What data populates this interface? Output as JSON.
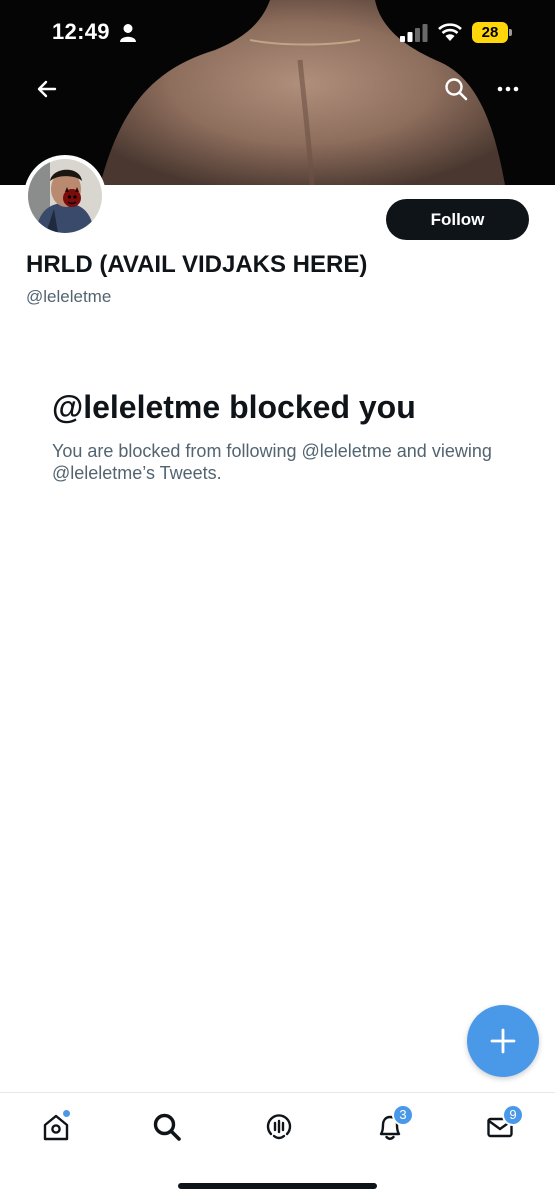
{
  "status_bar": {
    "time": "12:49",
    "battery": "28"
  },
  "profile": {
    "display_name": "HRLD (AVAIL VIDJAKS HERE)",
    "handle": "@leleletme",
    "follow_label": "Follow"
  },
  "blocked": {
    "title": "@leleletme blocked you",
    "message": "You are blocked from following @leleletme and viewing @leleletme’s Tweets."
  },
  "tab_bar": {
    "notifications_count": "3",
    "messages_count": "9"
  },
  "colors": {
    "accent": "#4a99e9",
    "follow_button": "#0f1419",
    "secondary_text": "#536471",
    "battery": "#ffd60a"
  },
  "icons": {
    "back": "arrow-left-icon",
    "search": "search-icon",
    "more": "more-horizontal-icon",
    "compose": "plus-icon",
    "home": "home-icon",
    "explore": "search-icon",
    "spaces": "spaces-icon",
    "notifications": "bell-icon",
    "messages": "mail-icon"
  }
}
